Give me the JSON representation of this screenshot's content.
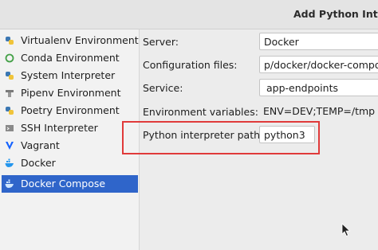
{
  "window": {
    "title": "Add Python Interp"
  },
  "sidebar": {
    "items": [
      {
        "label": "Virtualenv Environment",
        "icon": "python-icon"
      },
      {
        "label": "Conda Environment",
        "icon": "conda-ring-icon"
      },
      {
        "label": "System Interpreter",
        "icon": "python-icon"
      },
      {
        "label": "Pipenv Environment",
        "icon": "pipenv-icon"
      },
      {
        "label": "Poetry Environment",
        "icon": "python-icon"
      },
      {
        "label": "SSH Interpreter",
        "icon": "ssh-terminal-icon"
      },
      {
        "label": "Vagrant",
        "icon": "vagrant-v-icon"
      },
      {
        "label": "Docker",
        "icon": "docker-whale-icon"
      },
      {
        "label": "Docker Compose",
        "icon": "docker-whale-icon"
      }
    ],
    "selected": "Docker Compose"
  },
  "form": {
    "server_label": "Server:",
    "server_value": "Docker",
    "config_label": "Configuration files:",
    "config_value": "p/docker/docker-compose",
    "service_label": "Service:",
    "service_value": "app-endpoints",
    "envvars_label": "Environment variables:",
    "envvars_value": "ENV=DEV;TEMP=/tmp",
    "interp_label": "Python interpreter path:",
    "interp_value": "python3"
  },
  "colors": {
    "selection": "#2f65ca",
    "highlight_box": "#e03a3a"
  }
}
